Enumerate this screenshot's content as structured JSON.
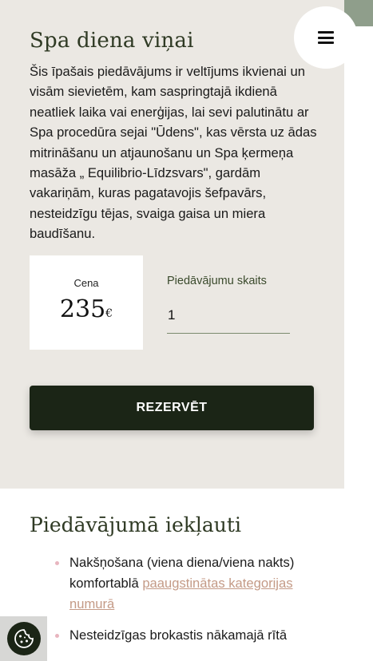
{
  "colors": {
    "panel_bg": "#ebe8e3",
    "accent_dark": "#1b2516",
    "title_green": "#2f3a24",
    "link": "#c49a86",
    "bullet": "#e8b5bf",
    "strip": "#8f9e8b"
  },
  "header": {
    "menu_icon": "hamburger-icon"
  },
  "offer": {
    "title": "Spa diena viņai",
    "description": "Šis īpašais piedāvājums ir veltījums ikvienai un visām sievietēm, kam saspringtajā ikdienā neatliek laika vai enerģijas, lai sevi palutinātu ar Spa procedūra sejai \"Ūdens\", kas vērsta uz ādas mitrināšanu un atjaunošanu un Spa ķermeņa masāža „ Equilibrio-Līdzsvars\", gardām vakariņām, kuras pagatavojis šefpavārs, nesteidzīgu tējas, svaiga gaisa un miera baudīšanu."
  },
  "price": {
    "label": "Cena",
    "amount": "235",
    "currency": "€"
  },
  "quantity": {
    "label": "Piedāvājumu skaits",
    "value": "1"
  },
  "reserve_button": "REZERVĒT",
  "included": {
    "title": "Piedāvājumā iekļauti",
    "items": [
      {
        "text": "Nakšņošana (viena diena/viena nakts) komfortablā ",
        "link": "paaugstinātas kategorijas numurā"
      },
      {
        "text": "Nesteidzīgas brokastis nākamajā rītā"
      }
    ]
  },
  "cookie": {
    "icon": "cookie-icon"
  }
}
